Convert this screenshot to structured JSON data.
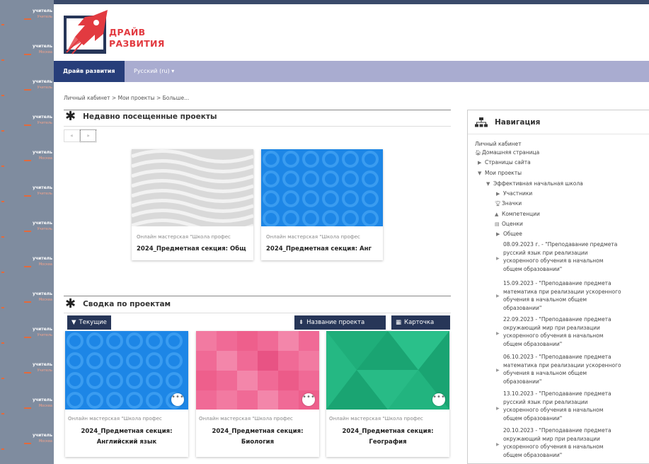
{
  "left_strip": {
    "items": [
      {
        "t1": "учитель",
        "t2": "Учитель"
      },
      {
        "t1": "учитель",
        "t2": "Москва"
      },
      {
        "t1": "учитель",
        "t2": "Учитель"
      },
      {
        "t1": "учитель",
        "t2": "Учитель"
      },
      {
        "t1": "учитель",
        "t2": "Москва"
      },
      {
        "t1": "учитель",
        "t2": "Учитель"
      },
      {
        "t1": "учитель",
        "t2": "Учитель"
      },
      {
        "t1": "учитель",
        "t2": "Москва"
      },
      {
        "t1": "учитель",
        "t2": "Москва"
      },
      {
        "t1": "учитель",
        "t2": "Учитель"
      },
      {
        "t1": "учитель",
        "t2": "Учитель"
      },
      {
        "t1": "учитель",
        "t2": "Москва"
      },
      {
        "t1": "учитель",
        "t2": "Москва"
      }
    ]
  },
  "logo": {
    "line1": "ДРАЙВ",
    "line2": "РАЗВИТИЯ"
  },
  "navbar": {
    "home": "Драйв развития",
    "lang": "Русский (ru) ▾"
  },
  "breadcrumb": "Личный кабинет > Мои проекты > Больше...",
  "recent": {
    "title": "Недавно посещенные проекты",
    "pager": {
      "prev": "«",
      "next": "»"
    },
    "cards": [
      {
        "category": "Онлайн мастерская \"Школа профес",
        "title": "2024_Предметная секция: Общ"
      },
      {
        "category": "Онлайн мастерская \"Школа профес",
        "title": "2024_Предметная секция: Анг"
      }
    ]
  },
  "overview": {
    "title": "Сводка по проектам",
    "filter_button": "Текущие",
    "sort_button": "Название проекта",
    "view_button": "Карточка",
    "more_icon": "•••",
    "cards": [
      {
        "category": "Онлайн мастерская \"Школа профес",
        "title_line1": "2024_Предметная секция:",
        "title_line2": "Английский язык"
      },
      {
        "category": "Онлайн мастерская \"Школа профес",
        "title_line1": "2024_Предметная секция:",
        "title_line2": "Биология"
      },
      {
        "category": "Онлайн мастерская \"Школа профес",
        "title_line1": "2024_Предметная секция:",
        "title_line2": "География"
      }
    ]
  },
  "navigation": {
    "title": "Навигация",
    "items": {
      "dashboard": "Личный кабинет",
      "home": "Домашняя страница",
      "site_pages": "Страницы сайта",
      "my_projects": "Мои проекты",
      "school": "Эффективная начальная школа",
      "participants": "Участники",
      "badges": "Значки",
      "competencies": "Компетенции",
      "grades": "Оценки",
      "general": "Общее"
    },
    "sections": [
      [
        "08.09.2023 г. - \"Преподавание предмета",
        "русский язык при реализации",
        "ускоренного обучения в начальном",
        "общем образовании\""
      ],
      [
        "15.09.2023 - \"Преподавание предмета",
        "математика при реализации ускоренного",
        "обучения в начальном общем",
        "образовании\""
      ],
      [
        "22.09.2023 - \"Преподавание предмета",
        "окружающий мир при реализации",
        "ускоренного обучения в начальном",
        "общем образовании\""
      ],
      [
        "06.10.2023 - \"Преподавание предмета",
        "математика при реализации ускоренного",
        "обучения в начальном общем",
        "образовании\""
      ],
      [
        "13.10.2023 - \"Преподавание предмета",
        "русский язык при реализации",
        "ускоренного обучения в начальном",
        "общем образовании\""
      ],
      [
        "20.10.2023 - \"Преподавание предмета",
        "окружающий мир при реализации",
        "ускоренного обучения в начальном",
        "общем образовании\""
      ]
    ]
  }
}
